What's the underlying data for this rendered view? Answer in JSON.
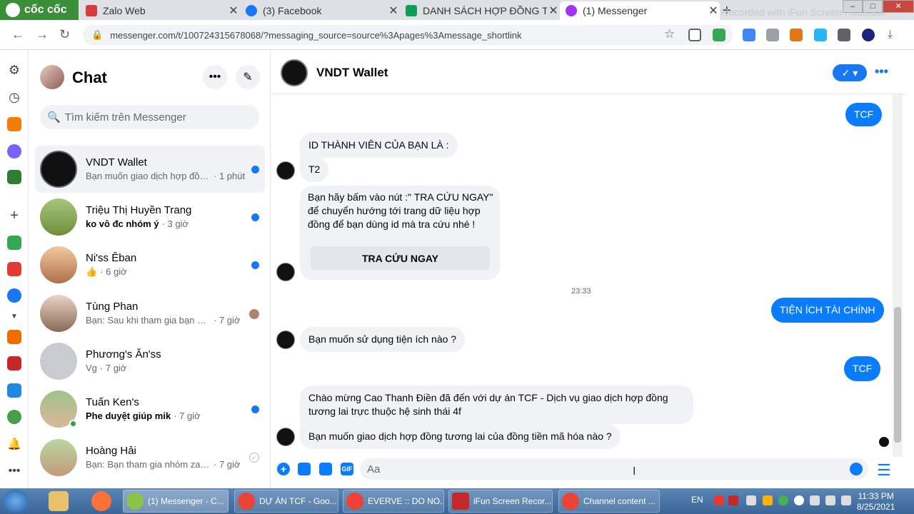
{
  "browser": {
    "brand": "cốc cốc",
    "tabs": [
      {
        "title": "Zalo Web",
        "color": "#d83b3b"
      },
      {
        "title": "(3) Facebook",
        "color": "#1877f2"
      },
      {
        "title": "DANH SÁCH HỢP ĐỒNG TU",
        "color": "#0f9d58"
      },
      {
        "title": "(1) Messenger",
        "color": "#a033ff"
      }
    ],
    "watermark": "Recorded with iFun Screen Recorder",
    "url": "messenger.com/t/100724315678068/?messaging_source=source%3Apages%3Amessage_shortlink"
  },
  "sidebar": {
    "title": "Chat",
    "search_placeholder": "Tìm kiếm trên Messenger",
    "conversations": [
      {
        "name": "VNDT Wallet",
        "preview": "Bạn muốn giao dịch hợp đồn...",
        "time": "· 1 phút",
        "unread": true,
        "bold": false
      },
      {
        "name": "Triệu Thị Huyền Trang",
        "preview": "ko vô đc nhóm ý",
        "time": "· 3 giờ",
        "unread": true,
        "bold": true
      },
      {
        "name": "Ni'ss Êban",
        "preview": "👍",
        "time": "· 6 giờ",
        "unread": true,
        "bold": false
      },
      {
        "name": "Tùng Phan",
        "preview": "Bạn: Sau khi tham gia bạn sẽ đ...",
        "time": "· 7 giờ",
        "unread": false,
        "bold": false
      },
      {
        "name": "Phương's Ăn'ss",
        "preview": "Vg",
        "time": "· 7 giờ",
        "unread": false,
        "bold": false
      },
      {
        "name": "Tuấn Ken's",
        "preview": "Phe duyệt giúp mik",
        "time": "· 7 giờ",
        "unread": true,
        "bold": true
      },
      {
        "name": "Hoàng Hải",
        "preview": "Bạn: Bạn tham gia nhóm zalo h...",
        "time": "· 7 giờ",
        "unread": false,
        "bold": false
      }
    ]
  },
  "conversation": {
    "name": "VNDT Wallet",
    "messages": {
      "m1": "TCF",
      "m2": "ID THÀNH VIÊN CỦA BẠN LÀ :",
      "m3": "T2",
      "card_text": "Bạn hãy bấm vào nút :\" TRA CỨU NGAY\" để chuyển hướng tới trang dữ liệu hợp đồng để bạn dùng id mà tra cứu nhé !",
      "card_button": "TRA CỨU NGAY",
      "timestamp": "23:33",
      "m4": "TIỆN ÍCH TÀI CHÍNH",
      "m5": "Bạn muốn sử dụng tiện ích nào ?",
      "m6": "TCF",
      "m7": "Chào mừng Cao Thanh Điền đã đến với dự án TCF - Dịch vụ giao dịch hợp đồng tương lai trực thuộc hệ sinh thái 4f",
      "m8": "Bạn muốn giao dịch hợp đồng tương lai của đồng tiền mã hóa nào ?"
    },
    "composer_placeholder": "Aa"
  },
  "taskbar": {
    "items": [
      "(1) Messenger - C...",
      "DỰ ÁN TCF - Goo...",
      "EVERVE :: DO NO...",
      "iFun Screen Recor...",
      "Channel content ..."
    ],
    "lang": "EN",
    "time": "11:33 PM",
    "date": "8/25/2021"
  },
  "colors": {
    "accent": "#1877f2",
    "outgoing": "#0a7cff",
    "incoming": "#f0f2f5"
  }
}
